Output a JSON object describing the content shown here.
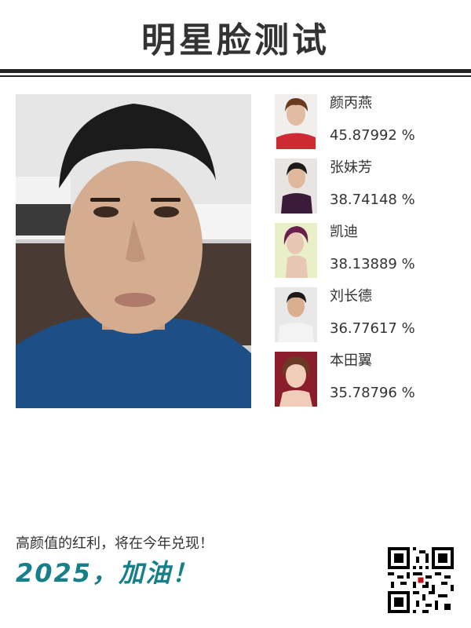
{
  "header": {
    "title": "明星脸测试"
  },
  "results": [
    {
      "name": "颜丙燕",
      "score": "45.87992 %"
    },
    {
      "name": "张妹芳",
      "score": "38.74148 %"
    },
    {
      "name": "凯迪",
      "score": "38.13889 %"
    },
    {
      "name": "刘长德",
      "score": "36.77617 %"
    },
    {
      "name": "本田翼",
      "score": "35.78796 %"
    }
  ],
  "footer": {
    "line": "高颜值的红利，将在今年兑现！",
    "slogan": "2025，加油！"
  },
  "colors": {
    "accent": "#167f8a",
    "text": "#333333"
  }
}
